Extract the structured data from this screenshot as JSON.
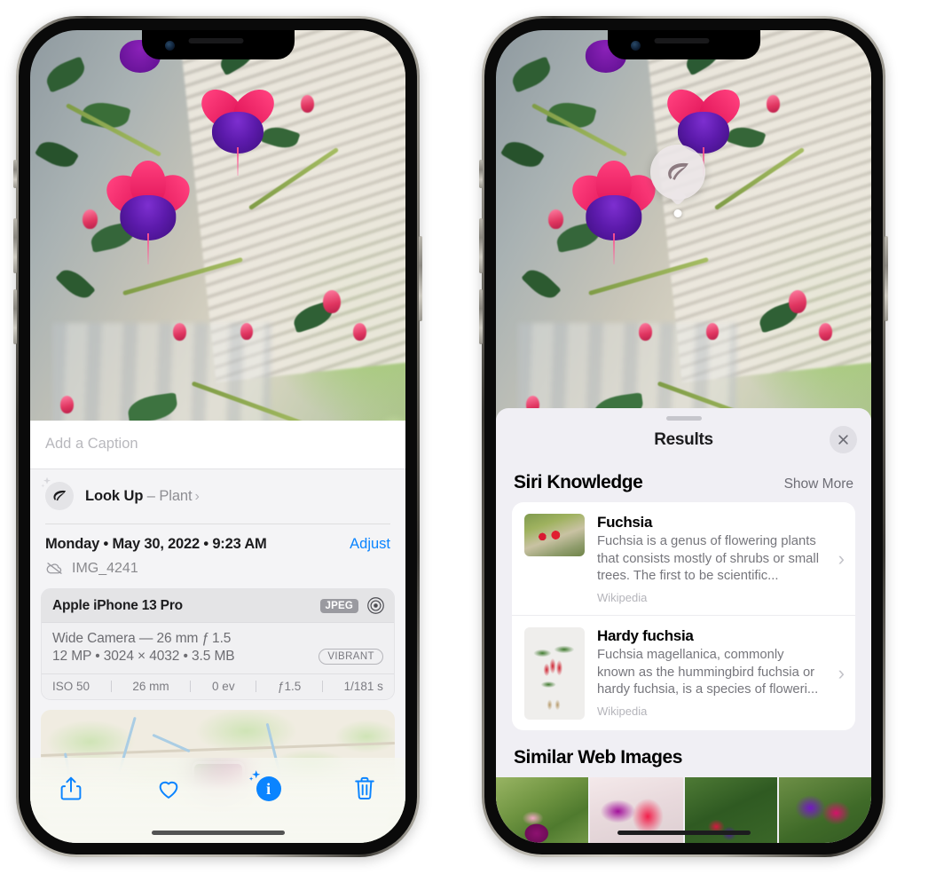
{
  "left_phone": {
    "photo": {
      "alt": "fuchsia-plant-photo"
    },
    "caption": {
      "placeholder": "Add a Caption",
      "value": ""
    },
    "lookup": {
      "icon": "leaf-icon",
      "sparkle_icon": "sparkle-icon",
      "label": "Look Up",
      "dash": " – ",
      "subject": "Plant",
      "chevron": "›"
    },
    "datetime": "Monday • May 30, 2022 • 9:23 AM",
    "adjust_label": "Adjust",
    "filename": "IMG_4241",
    "filename_icon": "cloud-slash-icon",
    "metadata": {
      "device": "Apple iPhone 13 Pro",
      "format_chip": "JPEG",
      "raw_icon": "aperture-icon",
      "lens_line": "Wide Camera — 26 mm ƒ 1.5",
      "specs_line": "12 MP • 3024 × 4032 • 3.5 MB",
      "style_chip": "VIBRANT",
      "exif": [
        "ISO 50",
        "26 mm",
        "0 ev",
        "ƒ1.5",
        "1/181 s"
      ]
    },
    "map": {
      "pin": "photo-thumbnail-pin"
    },
    "toolbar": {
      "share_icon": "share-icon",
      "favorite_icon": "heart-icon",
      "info_icon": "info-sparkle-icon",
      "delete_icon": "trash-icon"
    }
  },
  "right_phone": {
    "photo": {
      "alt": "fuchsia-plant-photo"
    },
    "lookup_badge": {
      "icon": "leaf-icon"
    },
    "sheet": {
      "title": "Results",
      "close_icon": "close-icon",
      "siri_knowledge": {
        "title": "Siri Knowledge",
        "show_more": "Show More",
        "items": [
          {
            "title": "Fuchsia",
            "description": "Fuchsia is a genus of flowering plants that consists mostly of shrubs or small trees. The first to be scientific...",
            "source": "Wikipedia",
            "chevron": "›",
            "thumb": "fuchsia-red-flowers-thumb"
          },
          {
            "title": "Hardy fuchsia",
            "description": "Fuchsia magellanica, commonly known as the hummingbird fuchsia or hardy fuchsia, is a species of floweri...",
            "source": "Wikipedia",
            "chevron": "›",
            "thumb": "hardy-fuchsia-specimen-thumb"
          }
        ]
      },
      "similar_web_images": {
        "title": "Similar Web Images",
        "images": [
          "similar-image-1",
          "similar-image-2",
          "similar-image-3",
          "similar-image-4"
        ]
      }
    }
  },
  "colors": {
    "accent_blue": "#0a84ff",
    "sheet_bg": "#f0eff4",
    "info_bg": "#f4f4f6",
    "card_white": "#ffffff",
    "secondary_text": "#8e8e93"
  }
}
